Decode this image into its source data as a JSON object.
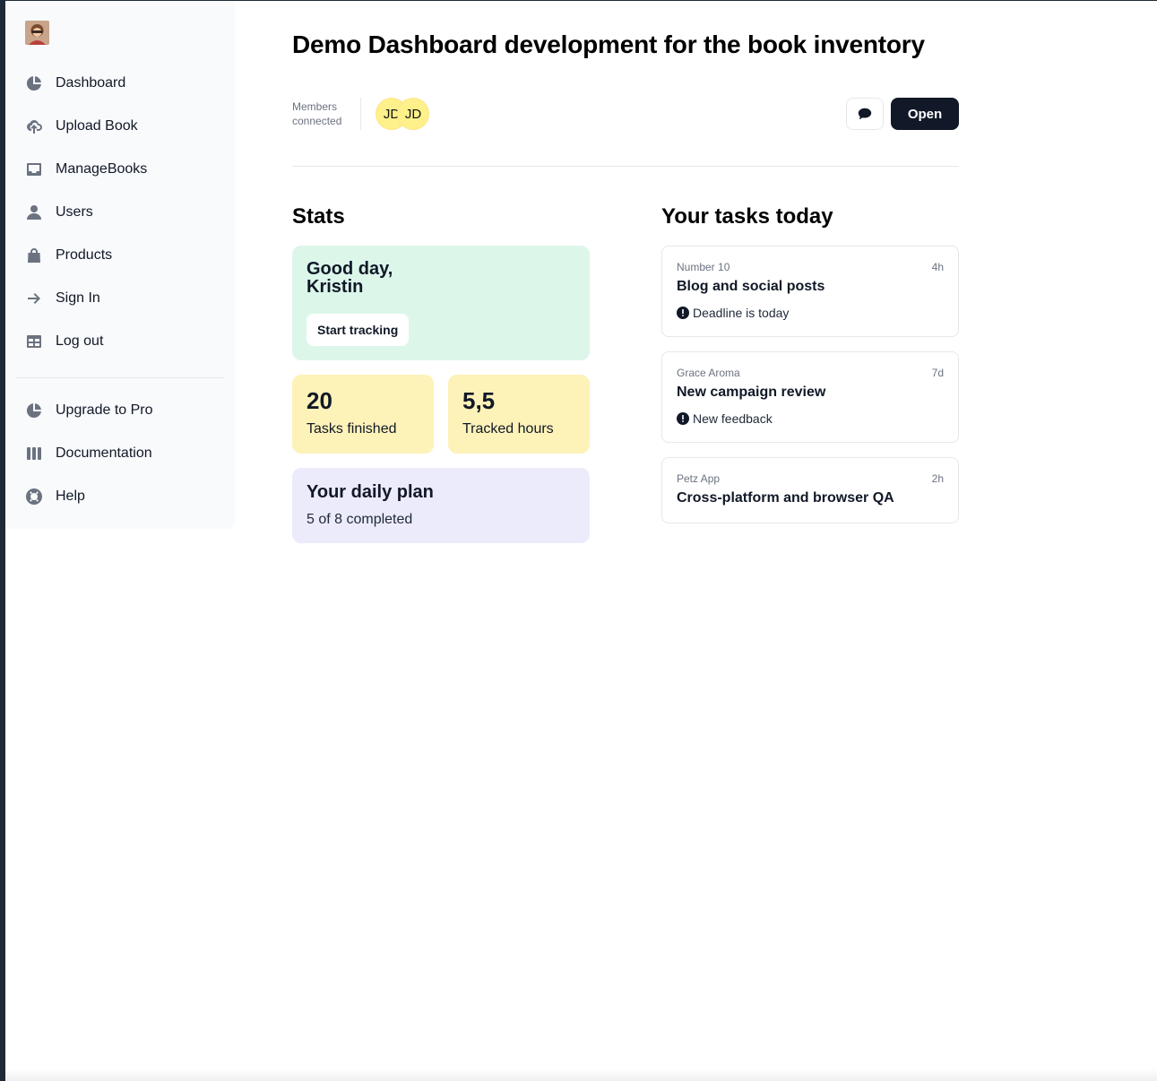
{
  "sidebar": {
    "logo_alt": "profile photo",
    "items": [
      {
        "label": "Dashboard",
        "icon": "pie-chart-icon"
      },
      {
        "label": "Upload Book",
        "icon": "cloud-upload-icon"
      },
      {
        "label": "ManageBooks",
        "icon": "inbox-icon"
      },
      {
        "label": "Users",
        "icon": "user-icon"
      },
      {
        "label": "Products",
        "icon": "shopping-bag-icon"
      },
      {
        "label": "Sign In",
        "icon": "arrow-right-icon"
      },
      {
        "label": "Log out",
        "icon": "table-icon"
      }
    ],
    "secondary": [
      {
        "label": "Upgrade to Pro",
        "icon": "pie-chart-icon"
      },
      {
        "label": "Documentation",
        "icon": "book-columns-icon"
      },
      {
        "label": "Help",
        "icon": "lifebuoy-icon"
      }
    ]
  },
  "header": {
    "title": "Demo Dashboard development for the book inventory",
    "members_label_1": "Members",
    "members_label_2": "connected",
    "avatars": [
      "JD",
      "JD"
    ],
    "open_label": "Open"
  },
  "stats": {
    "title": "Stats",
    "greeting_line1": "Good day,",
    "greeting_line2": "Kristin",
    "start_tracking": "Start tracking",
    "tasks_finished_value": "20",
    "tasks_finished_label": "Tasks finished",
    "tracked_hours_value": "5,5",
    "tracked_hours_label": "Tracked hours",
    "plan_title": "Your daily plan",
    "plan_sub": "5 of 8 completed"
  },
  "tasks": {
    "title": "Your tasks today",
    "items": [
      {
        "meta": "Number 10",
        "time": "4h",
        "title": "Blog and social posts",
        "note": "Deadline is today"
      },
      {
        "meta": "Grace Aroma",
        "time": "7d",
        "title": "New campaign review",
        "note": "New feedback"
      },
      {
        "meta": "Petz App",
        "time": "2h",
        "title": "Cross-platform and browser QA",
        "note": ""
      }
    ]
  },
  "colors": {
    "green_card": "#dcf7ea",
    "yellow_card": "#fdf2b8",
    "purple_card": "#ecebfb",
    "primary_button": "#111827"
  }
}
